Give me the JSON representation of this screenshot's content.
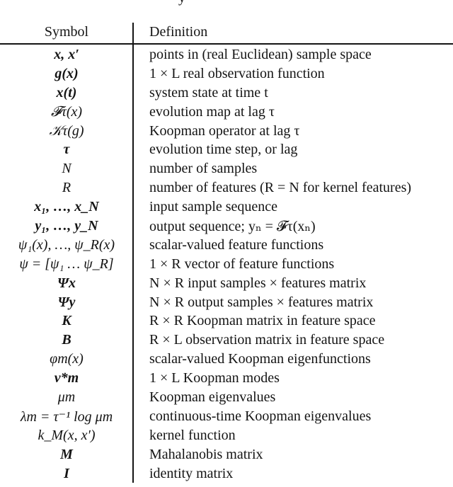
{
  "title_fragment": "y",
  "headers": {
    "symbol": "Symbol",
    "definition": "Definition"
  },
  "rows": [
    {
      "symbol": "x, x′",
      "definition": "points in (real Euclidean) sample space",
      "bold": true
    },
    {
      "symbol": "g(x)",
      "definition": "1 × L real observation function",
      "bold": true
    },
    {
      "symbol": "x(t)",
      "definition": "system state at time t",
      "bold": true
    },
    {
      "symbol": "𝓕τ(x)",
      "definition": "evolution map at lag τ",
      "bold": false
    },
    {
      "symbol": "𝒦τ(g)",
      "definition": "Koopman operator at lag τ",
      "bold": false
    },
    {
      "symbol": "τ",
      "definition": "evolution time step, or lag",
      "bold": true
    },
    {
      "symbol": "N",
      "definition": "number of samples",
      "bold": false
    },
    {
      "symbol": "R",
      "definition": "number of features (R = N for kernel features)",
      "bold": false
    },
    {
      "symbol": "x₁, …, x_N",
      "definition": "input sample sequence",
      "bold": true
    },
    {
      "symbol": "y₁, …, y_N",
      "definition": "output sequence; yₙ = 𝓕τ(xₙ)",
      "bold": true
    },
    {
      "symbol": "ψ₁(x), …, ψ_R(x)",
      "definition": "scalar-valued feature functions",
      "bold": false
    },
    {
      "symbol": "ψ = [ψ₁ … ψ_R]",
      "definition": "1 × R vector of feature functions",
      "bold": false
    },
    {
      "symbol": "Ψx",
      "definition": "N × R input samples × features matrix",
      "bold": true
    },
    {
      "symbol": "Ψy",
      "definition": "N × R output samples × features matrix",
      "bold": true
    },
    {
      "symbol": "K",
      "definition": "R × R Koopman matrix in feature space",
      "bold": true
    },
    {
      "symbol": "B",
      "definition": "R × L observation matrix in feature space",
      "bold": true
    },
    {
      "symbol": "φm(x)",
      "definition": "scalar-valued Koopman eigenfunctions",
      "bold": false
    },
    {
      "symbol": "v*m",
      "definition": "1 × L Koopman modes",
      "bold": true
    },
    {
      "symbol": "μm",
      "definition": "Koopman eigenvalues",
      "bold": false
    },
    {
      "symbol": "λm = τ⁻¹ log μm",
      "definition": "continuous-time Koopman eigenvalues",
      "bold": false
    },
    {
      "symbol": "k_M(x, x′)",
      "definition": "kernel function",
      "bold": false
    },
    {
      "symbol": "M",
      "definition": "Mahalanobis matrix",
      "bold": true
    },
    {
      "symbol": "I",
      "definition": "identity matrix",
      "bold": true
    }
  ]
}
